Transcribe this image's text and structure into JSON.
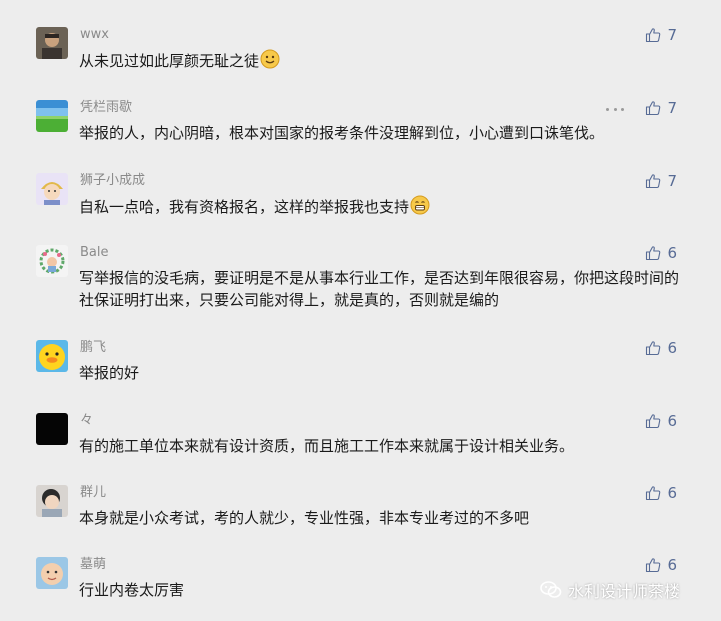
{
  "comments": [
    {
      "nickname": "wwx",
      "text": "从未见过如此厚颜无耻之徒",
      "likes": "7",
      "avatar_icon": "avatar-man-icon",
      "emoji_icon": "smile-emoji-icon"
    },
    {
      "nickname": "凭栏雨歇",
      "text": "举报的人，内心阴暗，根本对国家的报考条件没理解到位，小心遭到口诛笔伐。",
      "likes": "7",
      "avatar_icon": "avatar-landscape-icon"
    },
    {
      "nickname": "狮子小成成",
      "text": "自私一点哈，我有资格报名，这样的举报我也支持",
      "likes": "7",
      "avatar_icon": "avatar-cartoon-kid-icon",
      "emoji_icon": "grin-emoji-icon"
    },
    {
      "nickname": "Bale",
      "text": "写举报信的没毛病，要证明是不是从事本行业工作，是否达到年限很容易，你把这段时间的社保证明打出来，只要公司能对得上，就是真的，否则就是编的",
      "likes": "6",
      "avatar_icon": "avatar-wreath-icon"
    },
    {
      "nickname": "鹏飞",
      "text": "举报的好",
      "likes": "6",
      "avatar_icon": "avatar-duck-icon"
    },
    {
      "nickname": "々",
      "text": "有的施工单位本来就有设计资质，而且施工工作本来就属于设计相关业务。",
      "likes": "6",
      "avatar_icon": "avatar-black-icon"
    },
    {
      "nickname": "群儿",
      "text": "本身就是小众考试，考的人就少，专业性强，非本专业考过的不多吧",
      "likes": "6",
      "avatar_icon": "avatar-child-icon"
    },
    {
      "nickname": "墓萌",
      "text": "行业内卷太厉害",
      "likes": "6",
      "avatar_icon": "avatar-baby-icon"
    }
  ],
  "watermark": {
    "text": "水利设计师茶楼",
    "icon": "wechat-icon"
  },
  "colors": {
    "background": "#ededed",
    "nickname": "#8a8a8a",
    "text": "#1a1a1a",
    "like": "#576b95"
  }
}
